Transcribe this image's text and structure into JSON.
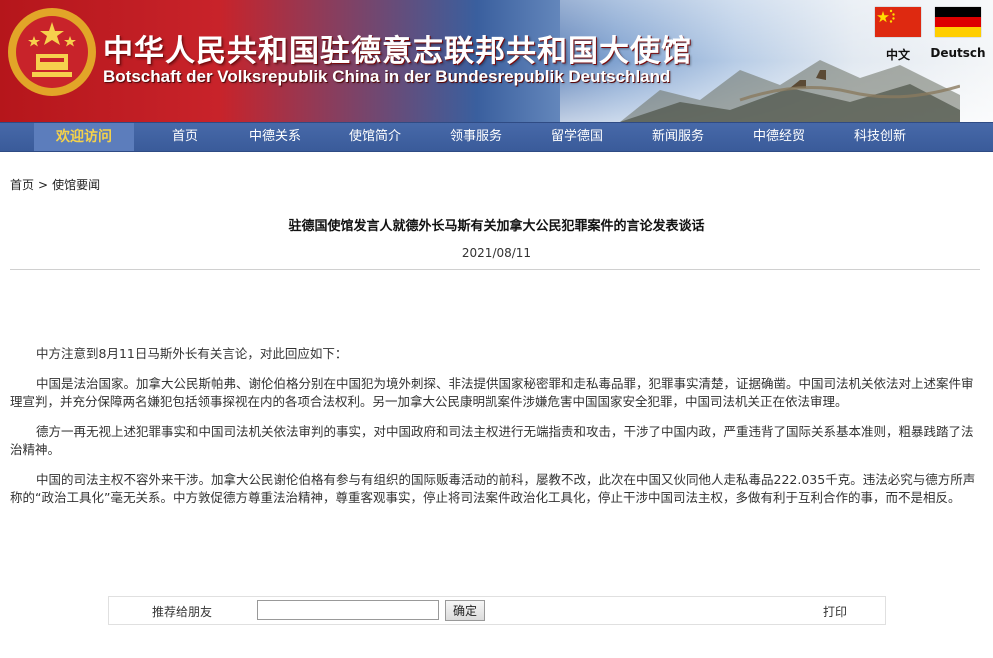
{
  "header": {
    "title_cn": "中华人民共和国驻德意志联邦共和国大使馆",
    "title_de": "Botschaft der Volksrepublik China in der Bundesrepublik Deutschland",
    "lang_cn": "中文",
    "lang_de": "Deutsch",
    "colors": {
      "banner_red": "#c8232a",
      "nav_blue": "#3f61a3",
      "welcome_yellow": "#f5d24a"
    }
  },
  "nav": {
    "welcome": "欢迎访问",
    "items": [
      "首页",
      "中德关系",
      "使馆简介",
      "领事服务",
      "留学德国",
      "新闻服务",
      "中德经贸",
      "科技创新"
    ]
  },
  "breadcrumb": {
    "home": "首页",
    "sep": ">",
    "current": "使馆要闻"
  },
  "article": {
    "title": "驻德国使馆发言人就德外长马斯有关加拿大公民犯罪案件的言论发表谈话",
    "date": "2021/08/11",
    "paragraphs": [
      "中方注意到8月11日马斯外长有关言论，对此回应如下：",
      "中国是法治国家。加拿大公民斯帕弗、谢伦伯格分别在中国犯为境外刺探、非法提供国家秘密罪和走私毒品罪，犯罪事实清楚，证据确凿。中国司法机关依法对上述案件审理宣判，并充分保障两名嫌犯包括领事探视在内的各项合法权利。另一加拿大公民康明凯案件涉嫌危害中国国家安全犯罪，中国司法机关正在依法审理。",
      "德方一再无视上述犯罪事实和中国司法机关依法审判的事实，对中国政府和司法主权进行无端指责和攻击，干涉了中国内政，严重违背了国际关系基本准则，粗暴践踏了法治精神。",
      "中国的司法主权不容外来干涉。加拿大公民谢伦伯格有参与有组织的国际贩毒活动的前科，屡教不改，此次在中国又伙同他人走私毒品222.035千克。违法必究与德方所声称的“政治工具化”毫无关系。中方敦促德方尊重法治精神，尊重客观事实，停止将司法案件政治化工具化，停止干涉中国司法主权，多做有利于互利合作的事，而不是相反。"
    ]
  },
  "recommend": {
    "label": "推荐给朋友",
    "input_value": "",
    "button": "确定",
    "print": "打印"
  }
}
